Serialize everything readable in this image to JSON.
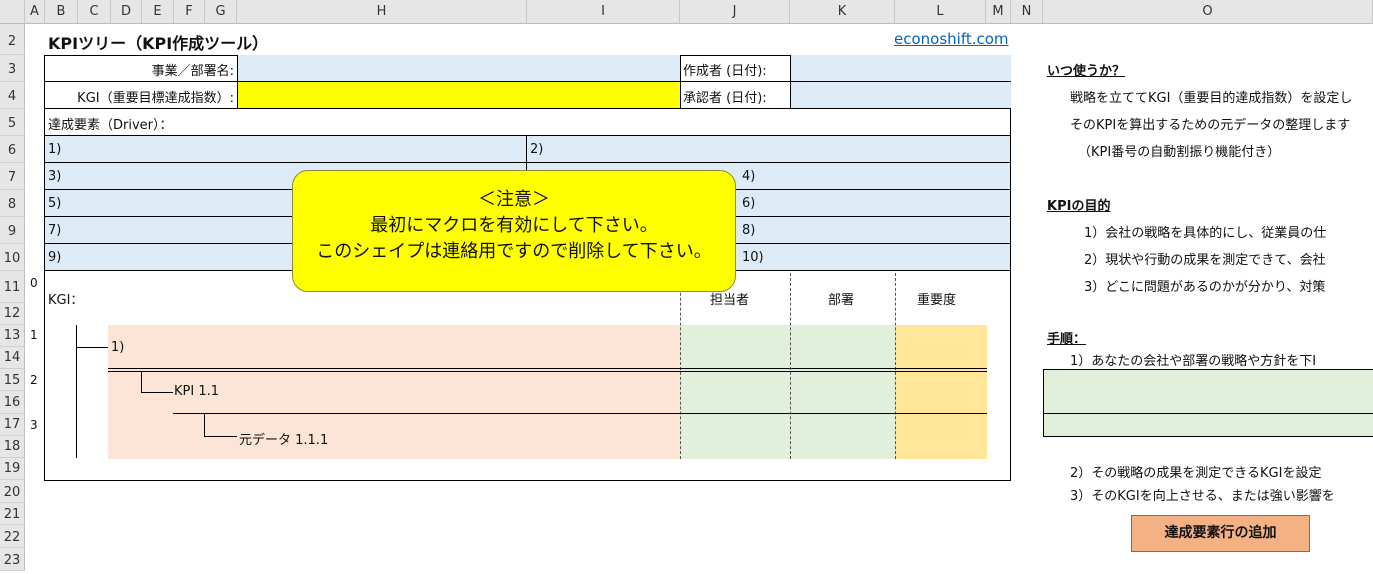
{
  "columns": [
    "A",
    "B",
    "C",
    "D",
    "E",
    "F",
    "G",
    "H",
    "I",
    "J",
    "K",
    "L",
    "M",
    "N",
    "O"
  ],
  "rows": [
    "2",
    "3",
    "4",
    "5",
    "6",
    "7",
    "8",
    "9",
    "10",
    "11",
    "12",
    "13",
    "14",
    "15",
    "16",
    "17",
    "18",
    "19",
    "20",
    "21",
    "22",
    "23"
  ],
  "sheet": {
    "title": "KPIツリー（KPI作成ツール）",
    "site_link": "econoshift.com",
    "dept_label": "事業／部署名:",
    "kgi_label": "KGI（重要目標達成指数）:",
    "creator_label": "作成者 (日付):",
    "approver_label": "承認者 (日付):",
    "driver_label": "達成要素（Driver）：",
    "drivers": [
      "1)",
      "2)",
      "3)",
      "4)",
      "5)",
      "6)",
      "7)",
      "8)",
      "9)",
      "10)"
    ],
    "levels": [
      "0",
      "1",
      "2",
      "3"
    ],
    "kgi_row_label": "KGI：",
    "header_owner": "担当者",
    "header_dept": "部署",
    "header_priority": "重要度",
    "tree_1": "1)",
    "tree_kpi": "KPI 1.1",
    "tree_source": "元データ 1.1.1"
  },
  "notice": {
    "line1": "＜注意＞",
    "line2": "最初にマクロを有効にして下さい。",
    "line3": "このシェイプは連絡用ですので削除して下さい。"
  },
  "info": {
    "when_title": "いつ使うか？",
    "when_1": "戦略を立ててKGI（重要目的達成指数）を設定し",
    "when_2": "そのKPIを算出するための元データの整理します",
    "when_3": "（KPI番号の自動割振り機能付き）",
    "purpose_title": "KPIの目的",
    "purpose_1": "1）会社の戦略を具体的にし、従業員の仕",
    "purpose_2": "2）現状や行動の成果を測定できて、会社",
    "purpose_3": "3）どこに問題があるのかが分かり、対策",
    "steps_title": "手順：",
    "step_1": "1）あなたの会社や部署の戦略や方針を下I",
    "step_2": "2）その戦略の成果を測定できるKGIを設定",
    "step_3": "3）そのKGIを向上させる、または強い影響を",
    "add_button": "達成要素行の追加"
  },
  "colors": {
    "blue_fill": "#ddebf7",
    "yellow_fill": "#ffff00",
    "salmon_fill": "#fce4d6",
    "green_fill": "#e2efda",
    "orange_fill": "#ffe699",
    "button_fill": "#f4b183",
    "link": "#0563c1"
  }
}
